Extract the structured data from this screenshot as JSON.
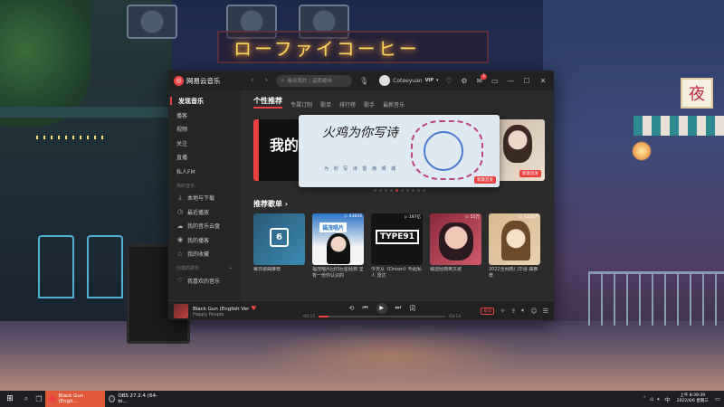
{
  "wallpaper": {
    "neon_sign": "ローファイコーヒー",
    "night_sign": "夜"
  },
  "app": {
    "name": "网易云音乐",
    "search_placeholder": "秦岚我的 | 温柔暖味",
    "user": {
      "name": "Coteeyuan",
      "vip": "VIP"
    },
    "mail_badge": "1",
    "colors": {
      "accent": "#ec4141",
      "sidebar": "#252525",
      "content": "#2b2b2b"
    }
  },
  "sidebar": {
    "items": [
      {
        "label": "发现音乐",
        "active": true
      },
      {
        "label": "播客"
      },
      {
        "label": "视频"
      },
      {
        "label": "关注"
      },
      {
        "label": "直播"
      },
      {
        "label": "私人FM"
      }
    ],
    "my_music_header": "我的音乐",
    "my_music": [
      {
        "label": "本地与下载",
        "icon": "download-icon"
      },
      {
        "label": "最近播放",
        "icon": "clock-icon"
      },
      {
        "label": "我的音乐云盘",
        "icon": "cloud-icon"
      },
      {
        "label": "我的播客",
        "icon": "podcast-icon"
      },
      {
        "label": "我的收藏",
        "icon": "collection-icon"
      }
    ],
    "created_header": "创建的歌单",
    "created_add": "+",
    "created": [
      {
        "label": "我喜欢的音乐",
        "icon": "heart-icon"
      }
    ]
  },
  "tabs": [
    "个性推荐",
    "专属订制",
    "歌单",
    "排行榜",
    "歌手",
    "最新音乐"
  ],
  "banner": {
    "title": "火鸡为你写诗",
    "subtitle": "为 你 写 诗 雷 雨 倾 城",
    "tag": "新歌首发",
    "left_text": "我的",
    "right_tag": "新歌首发",
    "dots": 10,
    "active_dot": 4
  },
  "recommend": {
    "title": "推荐歌单 ›",
    "playlists": [
      {
        "title": "每日歌曲推荐",
        "count": "",
        "cover_text": "6"
      },
      {
        "title": "福茂唱片回归巨星经典  里有一份你认识的",
        "count": "▷ 43834",
        "cover_text": "福茂唱片"
      },
      {
        "title": "今天从《Drown》听起私人 雷达",
        "count": "▷ 197亿",
        "cover_text": "TYPE91"
      },
      {
        "title": "臻选经典英文歌",
        "count": "▷ 55万",
        "cover_text": ""
      },
      {
        "title": "2022全网热门华语 曲推荐",
        "count": "▷ 1266万",
        "cover_text": ""
      }
    ]
  },
  "player": {
    "title": "Black Gun (English Ver",
    "artist": "Happy People",
    "time_elapsed": "00:15",
    "time_total": "03:14",
    "progress": 0.08,
    "quality": "极高"
  },
  "taskbar": {
    "items": [
      {
        "label": "Black Gun (Engli...",
        "active": true,
        "color": "#ec4141"
      },
      {
        "label": "OBS 27.2.4 (64-bi...",
        "active": false,
        "color": "#333333"
      }
    ],
    "time": "上午 8:39:39",
    "date": "2022/4/6 星期三",
    "ime": "中"
  }
}
